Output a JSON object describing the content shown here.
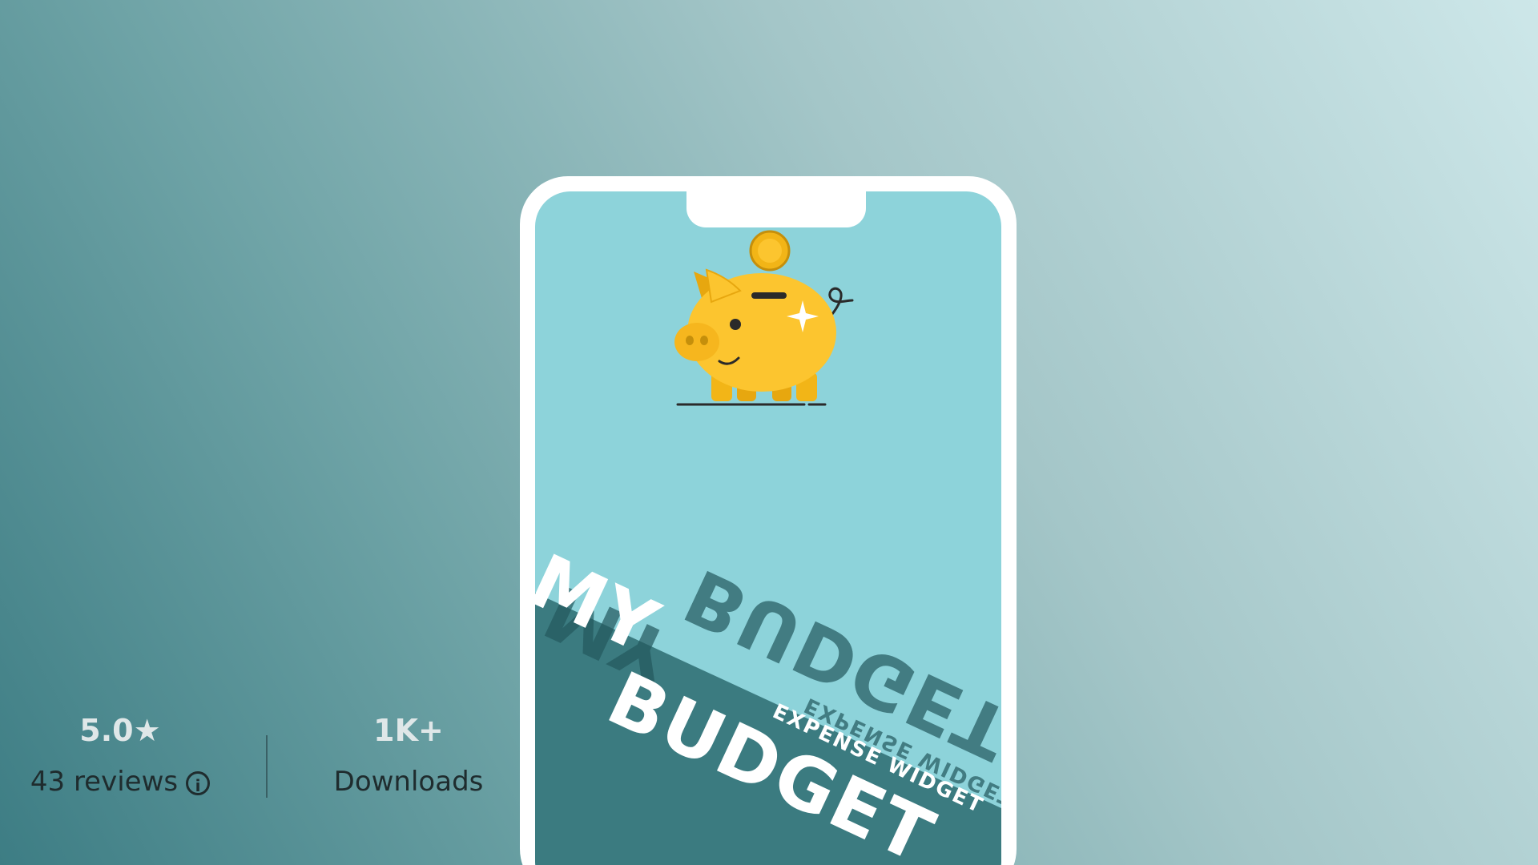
{
  "app": {
    "title_line1": "MY",
    "title_line2": "BUDGET",
    "subtitle": "EXPENSE WIDGET"
  },
  "stats": {
    "rating": "5.0★",
    "reviews": "43 reviews",
    "downloads": "1K+",
    "downloads_label": "Downloads"
  },
  "icons": {
    "piggy": "piggy-bank-icon",
    "coin": "coin-icon",
    "info": "info-icon",
    "star": "star-icon"
  },
  "colors": {
    "screen_bg": "#8dd3da",
    "screen_band": "#3b7b80",
    "piggy": "#fcc52f",
    "text": "#ffffff"
  }
}
